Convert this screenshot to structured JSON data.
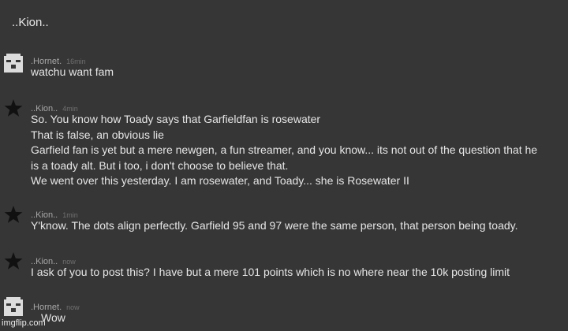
{
  "channel": {
    "title": "..Kion.."
  },
  "messages": [
    {
      "author": ".Hornet.",
      "time": "16min",
      "avatar": "pixel-face-icon",
      "lines": [
        "watchu want fam"
      ]
    },
    {
      "author": "..Kion..",
      "time": "4min",
      "avatar": "star-icon",
      "lines": [
        "So. You know how Toady says that Garfieldfan is rosewater",
        "That is false, an obvious lie",
        "Garfield fan is yet but a mere newgen, a fun streamer, and you know... its not out of the question that he",
        "is a toady alt. But i too, i don't choose to believe that.",
        "We went over this yesterday. I am rosewater, and Toady... she is Rosewater II"
      ]
    },
    {
      "author": "..Kion..",
      "time": "1min",
      "avatar": "star-icon",
      "lines": [
        "Y'know. The dots align perfectly. Garfield 95 and 97 were the same person, that person being toady."
      ]
    },
    {
      "author": "..Kion..",
      "time": "now",
      "avatar": "star-icon",
      "lines": [
        "I ask of you to post this? I have but a mere 101 points which is no where near the 10k posting limit"
      ]
    },
    {
      "author": ".Hornet.",
      "time": "now",
      "avatar": "pixel-face-icon",
      "lines": [
        "Wow"
      ]
    }
  ],
  "watermark": "imgflip.com",
  "colors": {
    "background": "#363636",
    "text": "#e6e6e6",
    "author": "#a8a8a8",
    "time": "#707070"
  }
}
